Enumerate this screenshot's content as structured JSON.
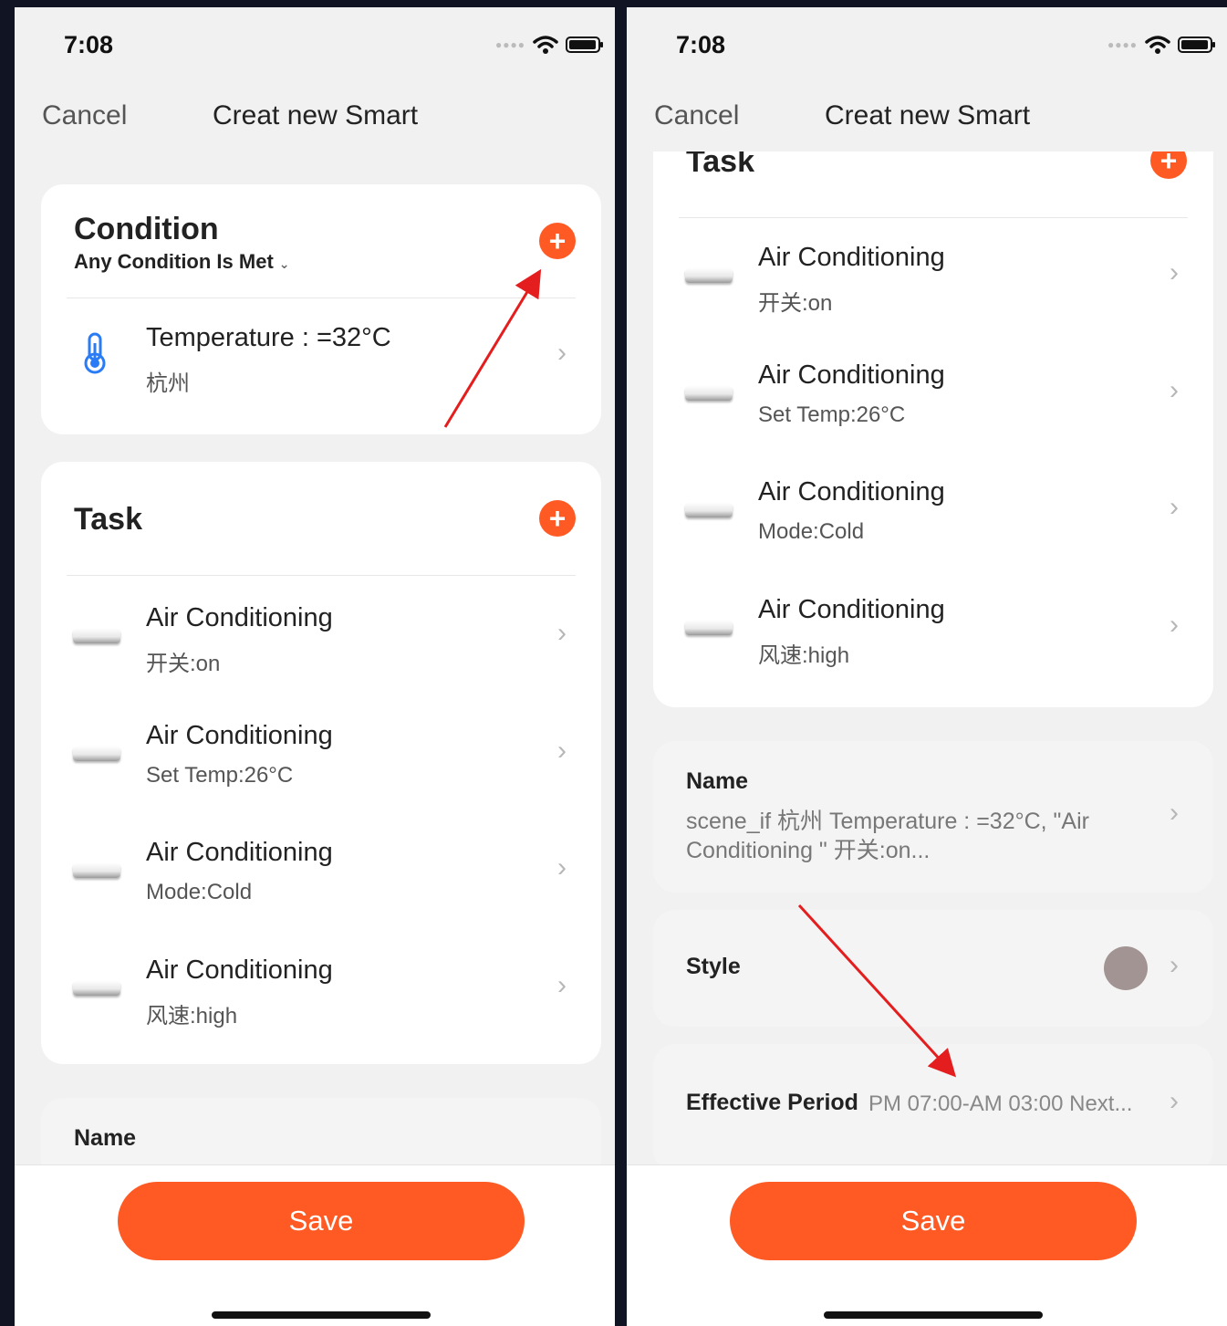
{
  "status": {
    "time": "7:08"
  },
  "nav": {
    "cancel": "Cancel",
    "title": "Creat new Smart"
  },
  "condition": {
    "title": "Condition",
    "mode": "Any Condition Is Met",
    "item": {
      "title": "Temperature : =32°C",
      "subtitle": "杭州"
    }
  },
  "task": {
    "title": "Task",
    "items": [
      {
        "title": "Air Conditioning",
        "subtitle": "开关:on"
      },
      {
        "title": "Air Conditioning",
        "subtitle": "Set Temp:26°C"
      },
      {
        "title": "Air Conditioning",
        "subtitle": "Mode:Cold"
      },
      {
        "title": "Air Conditioning",
        "subtitle": "风速:high"
      }
    ]
  },
  "name": {
    "label": "Name",
    "value": "scene_if 杭州 Temperature : =32°C, \"Air Conditioning \" 开关:on..."
  },
  "style": {
    "label": "Style",
    "color": "#a29493"
  },
  "effective_period": {
    "label": "Effective Period",
    "value": "PM 07:00-AM 03:00 Next..."
  },
  "save": {
    "label": "Save"
  },
  "colors": {
    "accent": "#ff5a24",
    "annotation": "#e41e1e"
  }
}
